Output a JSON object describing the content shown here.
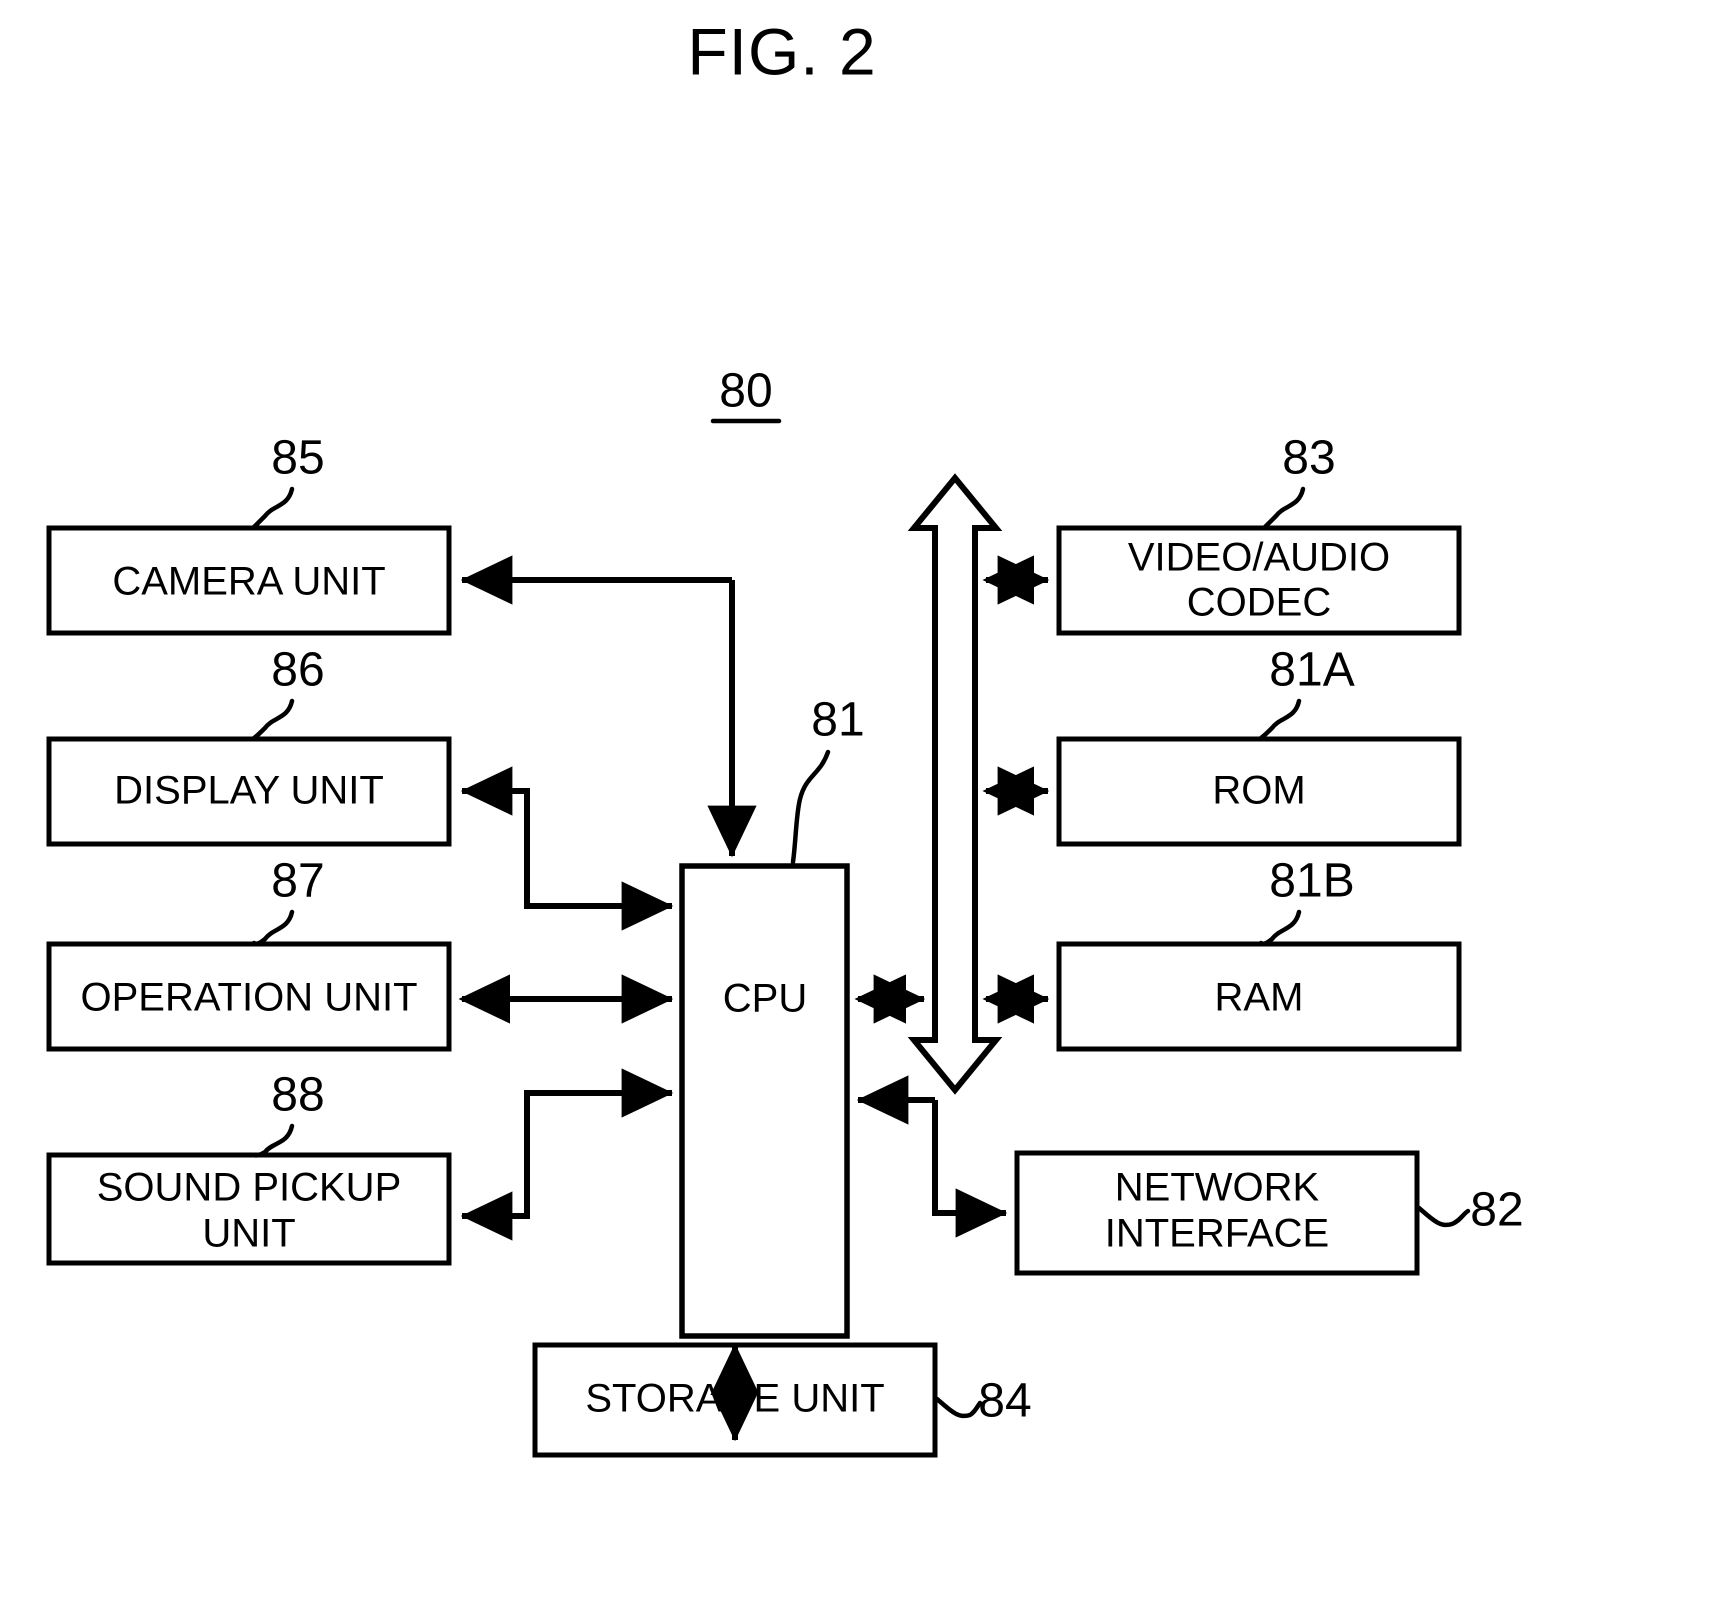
{
  "figure": {
    "title": "FIG. 2",
    "system_ref": "80"
  },
  "blocks": {
    "camera_unit": {
      "label": "CAMERA UNIT",
      "ref": "85"
    },
    "display_unit": {
      "label": "DISPLAY UNIT",
      "ref": "86"
    },
    "operation_unit": {
      "label": "OPERATION UNIT",
      "ref": "87"
    },
    "sound_pickup_unit": {
      "label_line1": "SOUND PICKUP",
      "label_line2": "UNIT",
      "ref": "88"
    },
    "cpu": {
      "label": "CPU",
      "ref": "81"
    },
    "video_audio_codec": {
      "label_line1": "VIDEO/AUDIO",
      "label_line2": "CODEC",
      "ref": "83"
    },
    "rom": {
      "label": "ROM",
      "ref": "81A"
    },
    "ram": {
      "label": "RAM",
      "ref": "81B"
    },
    "network_interface": {
      "label_line1": "NETWORK",
      "label_line2": "INTERFACE",
      "ref": "82"
    },
    "storage_unit": {
      "label": "STORAGE UNIT",
      "ref": "84"
    }
  },
  "colors": {
    "line": "#000000",
    "fill": "#ffffff",
    "text": "#000000"
  }
}
